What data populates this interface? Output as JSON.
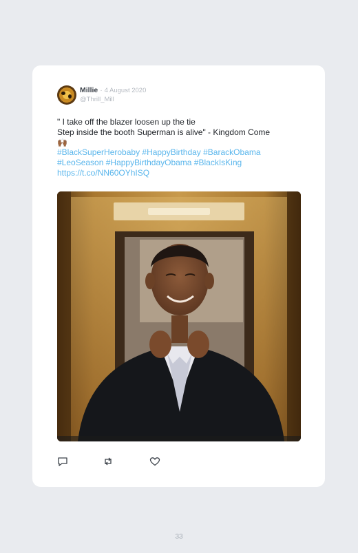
{
  "tweet": {
    "display_name": "Millie",
    "separator": "·",
    "date": "4 August 2020",
    "handle": "@Thrill_Mill",
    "text_lines": [
      "\" I take off the blazer loosen up the tie",
      "Step inside the booth Superman is alive\" - Kingdom Come"
    ],
    "emoji": "🙌🏾",
    "hashtag_lines": [
      "#BlackSuperHerobaby #HappyBirthday #BarackObama",
      "#LeoSeason #HappyBirthdayObama #BlackIsKing",
      "https://t.co/NN60OYhISQ"
    ],
    "image_alt": "photo"
  },
  "actions": [
    "reply-icon",
    "retweet-icon",
    "like-icon"
  ],
  "colors": {
    "background": "#e9ebef",
    "card": "#ffffff",
    "link": "#5ab6ec",
    "muted": "#b5bac1"
  },
  "page_number": "33"
}
